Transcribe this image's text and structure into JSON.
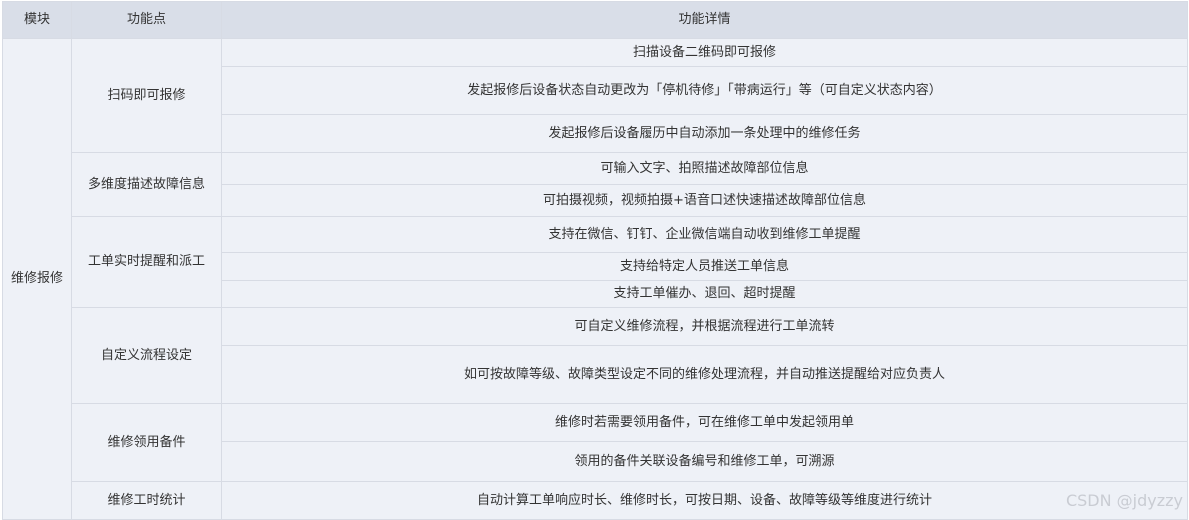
{
  "header": {
    "col_module": "模块",
    "col_feature": "功能点",
    "col_detail": "功能详情"
  },
  "module": "维修报修",
  "groups": [
    {
      "feature": "扫码即可报修",
      "details": [
        "扫描设备二维码即可报修",
        "发起报修后设备状态自动更改为「停机待修」「带病运行」等（可自定义状态内容）",
        "发起报修后设备履历中自动添加一条处理中的维修任务"
      ]
    },
    {
      "feature": "多维度描述故障信息",
      "details": [
        "可输入文字、拍照描述故障部位信息",
        "可拍摄视频，视频拍摄+语音口述快速描述故障部位信息"
      ]
    },
    {
      "feature": "工单实时提醒和派工",
      "details": [
        "支持在微信、钉钉、企业微信端自动收到维修工单提醒",
        "支持给特定人员推送工单信息",
        "支持工单催办、退回、超时提醒"
      ]
    },
    {
      "feature": "自定义流程设定",
      "details": [
        "可自定义维修流程，并根据流程进行工单流转",
        "如可按故障等级、故障类型设定不同的维修处理流程，并自动推送提醒给对应负责人"
      ]
    },
    {
      "feature": "维修领用备件",
      "details": [
        "维修时若需要领用备件，可在维修工单中发起领用单",
        "领用的备件关联设备编号和维修工单，可溯源"
      ]
    },
    {
      "feature": "维修工时统计",
      "details": [
        "自动计算工单响应时长、维修时长，可按日期、设备、故障等级等维度进行统计"
      ]
    }
  ],
  "watermark": "CSDN @jdyzzy"
}
